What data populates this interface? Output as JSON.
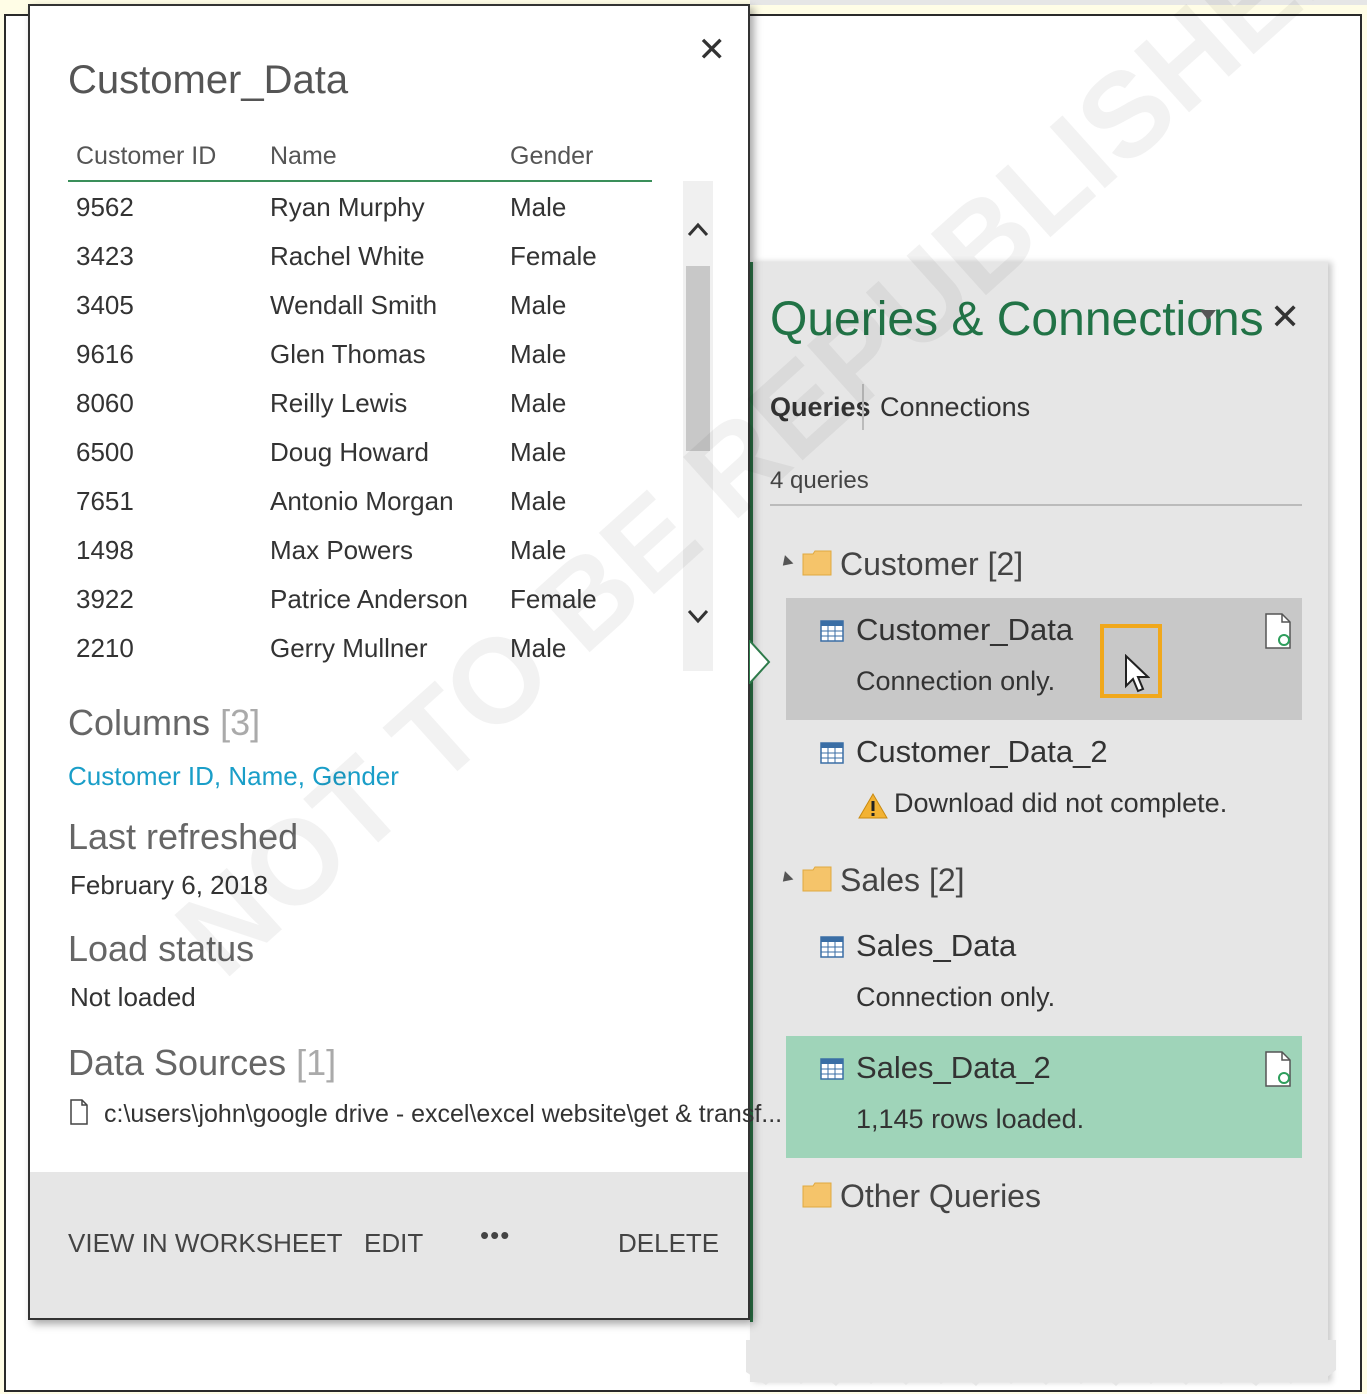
{
  "preview": {
    "title": "Customer_Data",
    "columns": [
      "Customer ID",
      "Name",
      "Gender"
    ],
    "rows": [
      [
        "9562",
        "Ryan Murphy",
        "Male"
      ],
      [
        "3423",
        "Rachel White",
        "Female"
      ],
      [
        "3405",
        "Wendall Smith",
        "Male"
      ],
      [
        "9616",
        "Glen Thomas",
        "Male"
      ],
      [
        "8060",
        "Reilly Lewis",
        "Male"
      ],
      [
        "6500",
        "Doug Howard",
        "Male"
      ],
      [
        "7651",
        "Antonio Morgan",
        "Male"
      ],
      [
        "1498",
        "Max Powers",
        "Male"
      ],
      [
        "3922",
        "Patrice Anderson",
        "Female"
      ],
      [
        "2210",
        "Gerry Mullner",
        "Male"
      ]
    ],
    "columns_heading": "Columns",
    "columns_count": "[3]",
    "columns_list": "Customer ID, Name, Gender",
    "last_refreshed_heading": "Last refreshed",
    "last_refreshed_value": "February 6, 2018",
    "load_status_heading": "Load status",
    "load_status_value": "Not loaded",
    "data_sources_heading": "Data Sources",
    "data_sources_count": "[1]",
    "data_source_path": "c:\\users\\john\\google drive - excel\\excel website\\get & transf...",
    "footer": {
      "view_in_worksheet": "VIEW IN WORKSHEET",
      "edit": "EDIT",
      "more": "•••",
      "delete": "DELETE"
    },
    "close": "✕"
  },
  "pane": {
    "title": "Queries & Connections",
    "close": "✕",
    "tabs": [
      "Queries",
      "Connections"
    ],
    "count_label": "4 queries",
    "groups": [
      {
        "name": "Customer [2]"
      },
      {
        "name": "Sales [2]"
      },
      {
        "name": "Other Queries"
      }
    ],
    "queries": [
      {
        "name": "Customer_Data",
        "status": "Connection only."
      },
      {
        "name": "Customer_Data_2",
        "status": "Download did not complete."
      },
      {
        "name": "Sales_Data",
        "status": "Connection only."
      },
      {
        "name": "Sales_Data_2",
        "status": "1,145 rows loaded."
      }
    ]
  },
  "watermark": "NOT TO BE REPUBLISHED",
  "colors": {
    "accent_green": "#217346",
    "link_blue": "#1a9ec8",
    "selected_gray": "#c8c8c8",
    "loaded_green": "#9fd4b9",
    "highlight_orange": "#f0a81c"
  }
}
